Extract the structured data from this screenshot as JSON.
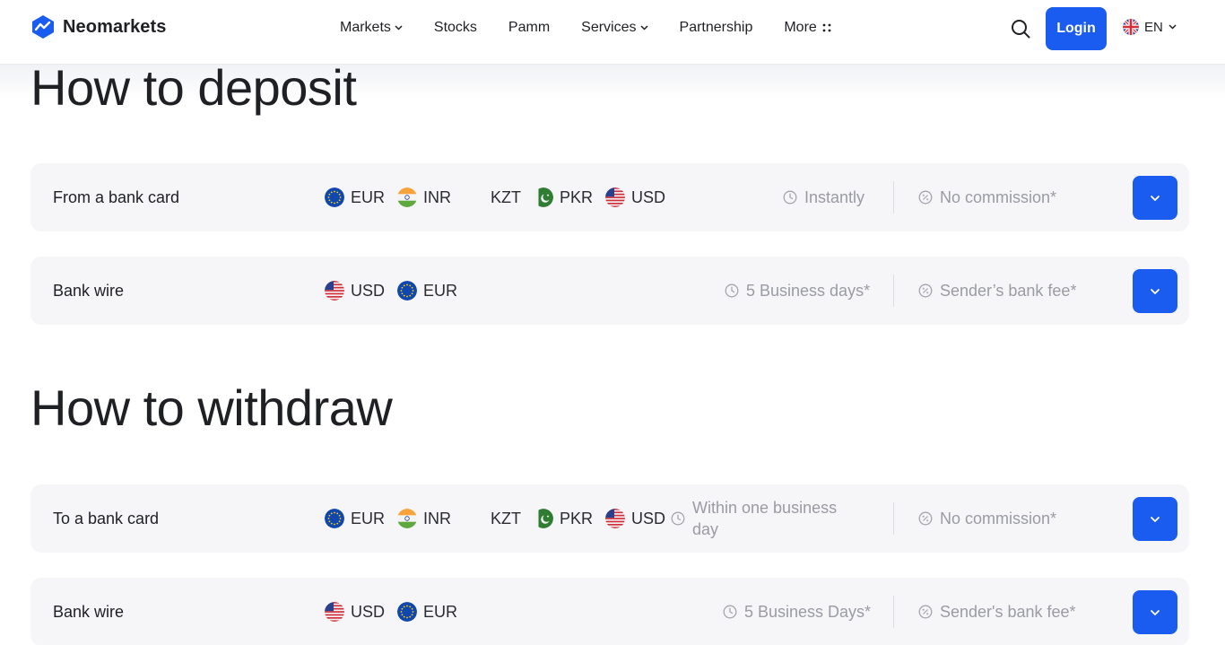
{
  "brand": {
    "name": "Neomarkets"
  },
  "nav": {
    "items": [
      {
        "label": "Markets",
        "has_dropdown": true
      },
      {
        "label": "Stocks"
      },
      {
        "label": "Pamm"
      },
      {
        "label": "Services",
        "has_dropdown": true
      },
      {
        "label": "Partnership"
      },
      {
        "label": "More",
        "icon": "grid-dots-icon"
      }
    ]
  },
  "header": {
    "login_label": "Login",
    "language": "EN",
    "search_icon": "search-icon"
  },
  "deposit": {
    "title": "How to deposit",
    "rows": [
      {
        "method": "From a bank card",
        "currencies": [
          "EUR",
          "INR",
          "KZT",
          "PKR",
          "USD"
        ],
        "time": "Instantly",
        "fee": "No commission*"
      },
      {
        "method": "Bank wire",
        "currencies": [
          "USD",
          "EUR"
        ],
        "time": "5 Business days*",
        "fee": "Sender’s bank fee*"
      }
    ]
  },
  "withdraw": {
    "title": "How to withdraw",
    "rows": [
      {
        "method": "To a bank card",
        "currencies": [
          "EUR",
          "INR",
          "KZT",
          "PKR",
          "USD"
        ],
        "time_line1": "Within one business",
        "time_line2": "day",
        "fee": "No commission*"
      },
      {
        "method": "Bank wire",
        "currencies": [
          "USD",
          "EUR"
        ],
        "time": "5 Business Days*",
        "fee": "Sender's bank fee*"
      }
    ]
  },
  "colors": {
    "accent": "#1b5cf0",
    "row_bg": "#f6f6f9",
    "muted_text": "#9a9ba3"
  }
}
